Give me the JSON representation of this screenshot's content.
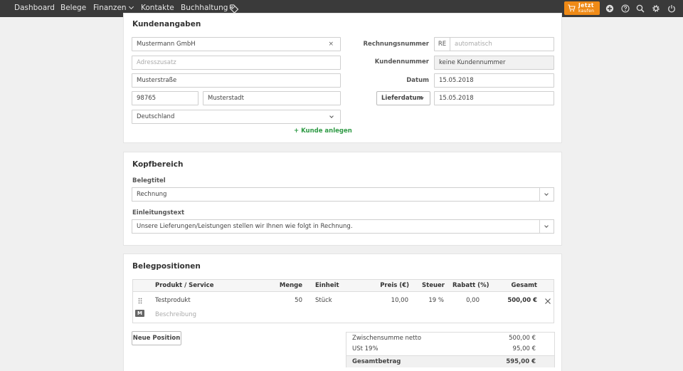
{
  "nav": {
    "items": [
      {
        "label": "Dashboard"
      },
      {
        "label": "Belege"
      },
      {
        "label": "Finanzen"
      },
      {
        "label": "Kontakte"
      },
      {
        "label": "Buchhaltung"
      }
    ],
    "buy_line1": "Jetzt",
    "buy_line2": "kaufen",
    "icons": [
      "tag-icon",
      "cart-icon",
      "plus-circle-icon",
      "help-icon",
      "search-icon",
      "settings-icon",
      "power-icon"
    ]
  },
  "customer": {
    "title": "Kundenangaben",
    "name": "Mustermann GmbH",
    "address_extra_placeholder": "Adresszusatz",
    "street": "Musterstraße",
    "zip": "98765",
    "city": "Musterstadt",
    "country": "Deutschland",
    "add_customer": "+ Kunde anlegen",
    "invoice_number_label": "Rechnungsnummer",
    "invoice_prefix": "RE",
    "invoice_number_placeholder": "automatisch",
    "customer_number_label": "Kundennummer",
    "customer_number": "keine Kundennummer",
    "date_label": "Datum",
    "date": "15.05.2018",
    "delivery_label": "Lieferdatum",
    "delivery_date": "15.05.2018"
  },
  "header_section": {
    "title": "Kopfbereich",
    "doc_title_label": "Belegtitel",
    "doc_title": "Rechnung",
    "intro_label": "Einleitungstext",
    "intro": "Unsere Lieferungen/Leistungen stellen wir Ihnen wie folgt in Rechnung."
  },
  "positions": {
    "title": "Belegpositionen",
    "columns": {
      "product": "Produkt / Service",
      "qty": "Menge",
      "unit": "Einheit",
      "price": "Preis (€)",
      "tax": "Steuer",
      "discount": "Rabatt (%)",
      "total": "Gesamt"
    },
    "rows": [
      {
        "product": "Testprodukt",
        "qty": "50",
        "unit": "Stück",
        "price": "10,00",
        "tax": "19 %",
        "discount": "0,00",
        "total": "500,00 €",
        "badge": "M",
        "description_placeholder": "Beschreibung"
      }
    ],
    "new_position": "Neue Position",
    "summary": {
      "subtotal_label": "Zwischensumme netto",
      "subtotal": "500,00 €",
      "vat_label": "USt 19%",
      "vat": "95,00 €",
      "total_label": "Gesamtbetrag",
      "total": "595,00 €"
    }
  }
}
